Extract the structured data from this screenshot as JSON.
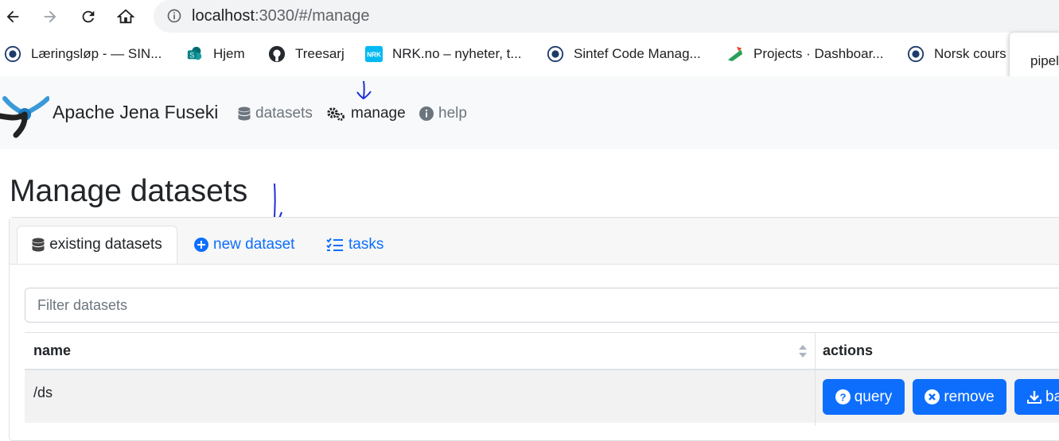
{
  "browser": {
    "url_host": "localhost",
    "url_rest": ":3030/#/manage",
    "bookmarks": [
      {
        "label": "Læringsløp - — SIN...",
        "icon": "sintef-logo-icon"
      },
      {
        "label": "Hjem",
        "icon": "sharepoint-icon"
      },
      {
        "label": "Treesarj",
        "icon": "github-icon"
      },
      {
        "label": "NRK.no – nyheter, t...",
        "icon": "nrk-icon"
      },
      {
        "label": "Sintef Code Manag...",
        "icon": "sintef-logo-icon"
      },
      {
        "label": "Projects · Dashboar...",
        "icon": "gitlab-icon"
      },
      {
        "label": "Norsk cours",
        "icon": "sintef-logo-icon"
      }
    ],
    "popup_text": "pipel"
  },
  "navbar": {
    "brand": "Apache Jena Fuseki",
    "links": {
      "datasets": "datasets",
      "manage": "manage",
      "help": "help"
    }
  },
  "page": {
    "title": "Manage datasets",
    "tabs": {
      "existing": "existing datasets",
      "new": "new dataset",
      "tasks": "tasks"
    },
    "filter_placeholder": "Filter datasets",
    "table": {
      "headers": {
        "name": "name",
        "actions": "actions"
      },
      "rows": [
        {
          "name": "/ds",
          "actions": {
            "query": "query",
            "remove": "remove",
            "backup": "ba"
          }
        }
      ]
    }
  },
  "colors": {
    "primary": "#0d6efd",
    "annotation": "#1f2fd6"
  }
}
